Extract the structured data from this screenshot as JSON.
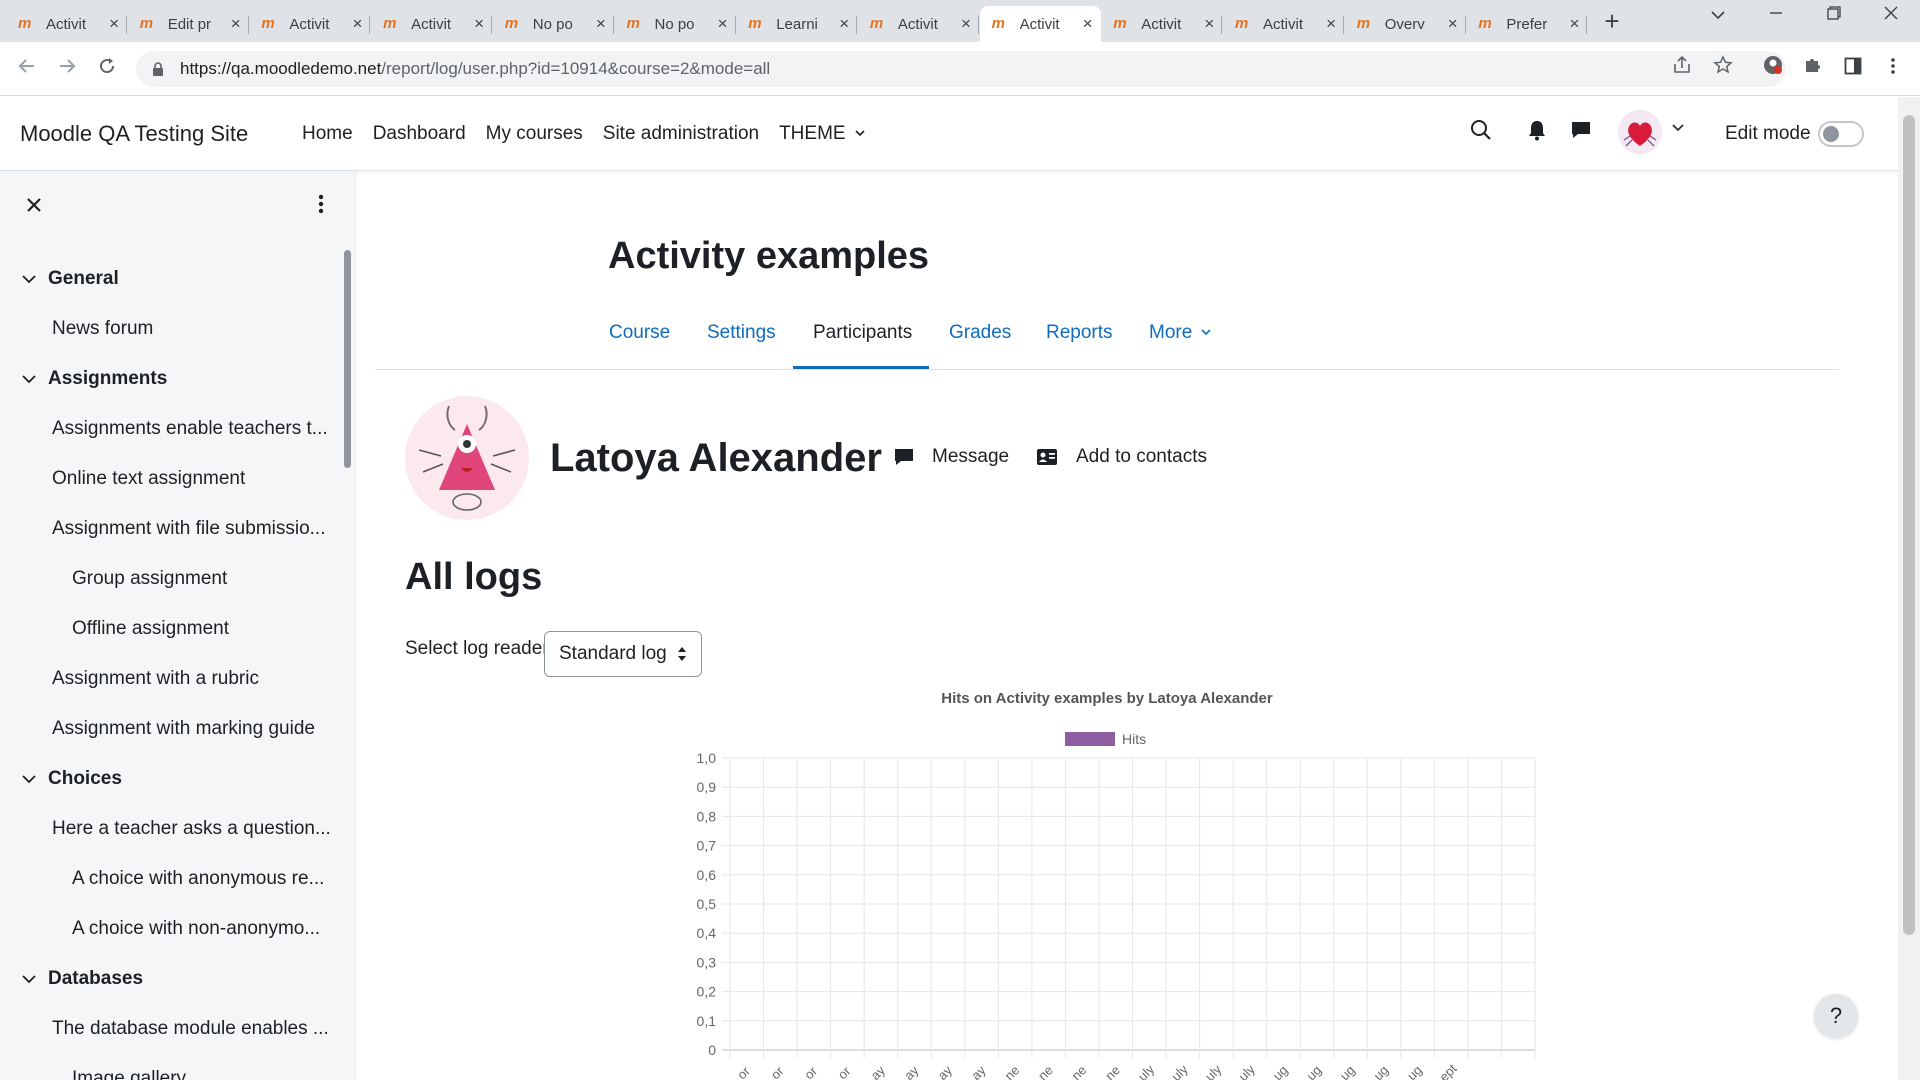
{
  "browser": {
    "tabs": [
      {
        "title": "Activit"
      },
      {
        "title": "Edit pr"
      },
      {
        "title": "Activit"
      },
      {
        "title": "Activit"
      },
      {
        "title": "No po"
      },
      {
        "title": "No po"
      },
      {
        "title": "Learni"
      },
      {
        "title": "Activit"
      },
      {
        "title": "Activit",
        "active": true
      },
      {
        "title": "Activit"
      },
      {
        "title": "Activit"
      },
      {
        "title": "Overv"
      },
      {
        "title": "Prefer"
      }
    ],
    "url_host": "https://qa.moodledemo.net",
    "url_path": "/report/log/user.php?id=10914&course=2&mode=all"
  },
  "navbar": {
    "brand": "Moodle QA Testing Site",
    "items": [
      "Home",
      "Dashboard",
      "My courses",
      "Site administration",
      "THEME"
    ],
    "edit_mode_label": "Edit mode",
    "edit_mode_on": false
  },
  "drawer": {
    "sections": [
      {
        "label": "General"
      },
      {
        "label": "Assignments"
      },
      {
        "label": "Choices"
      },
      {
        "label": "Databases"
      }
    ],
    "items": [
      {
        "label": "News forum"
      },
      {
        "label": "Assignments enable teachers t..."
      },
      {
        "label": "Online text assignment"
      },
      {
        "label": "Assignment with file submissio..."
      },
      {
        "label": "Group assignment"
      },
      {
        "label": "Offline assignment"
      },
      {
        "label": "Assignment with a rubric"
      },
      {
        "label": "Assignment with marking guide"
      },
      {
        "label": "Here a teacher asks a question..."
      },
      {
        "label": "A choice with anonymous re..."
      },
      {
        "label": "A choice with non-anonymo..."
      },
      {
        "label": "The database module enables ..."
      },
      {
        "label": "Image gallery"
      }
    ]
  },
  "course": {
    "title": "Activity examples",
    "tabs": [
      "Course",
      "Settings",
      "Participants",
      "Grades",
      "Reports",
      "More"
    ],
    "active_tab": "Participants"
  },
  "user": {
    "name": "Latoya Alexander",
    "message_label": "Message",
    "contacts_label": "Add to contacts"
  },
  "logs": {
    "heading": "All logs",
    "reader_label": "Select log reader",
    "reader_value": "Standard log"
  },
  "chart_data": {
    "type": "bar",
    "title": "Hits on Activity examples by Latoya Alexander",
    "legend": "Hits",
    "series": [
      {
        "name": "Hits",
        "color": "#8e5ea2",
        "values": [
          0,
          0,
          0,
          0,
          0,
          0,
          0,
          0,
          0,
          0,
          0,
          0,
          0,
          0,
          0,
          0,
          0,
          0,
          0,
          0,
          0,
          0,
          0,
          0
        ]
      }
    ],
    "categories": [
      "or",
      "or",
      "or",
      "or",
      "ay",
      "ay",
      "ay",
      "ay",
      "ne",
      "ne",
      "ne",
      "ne",
      "uly",
      "uly",
      "uly",
      "uly",
      "ug",
      "ug",
      "ug",
      "ug",
      "ug",
      "ept"
    ],
    "ylim": [
      0,
      1.0
    ],
    "yticks": [
      "0",
      "0,1",
      "0,2",
      "0,3",
      "0,4",
      "0,5",
      "0,6",
      "0,7",
      "0,8",
      "0,9",
      "1,0"
    ],
    "grid": true
  },
  "colors": {
    "link": "#0f6cbf",
    "text": "#1d2125",
    "brand_orange": "#e8731b",
    "hits": "#8e5ea2"
  }
}
